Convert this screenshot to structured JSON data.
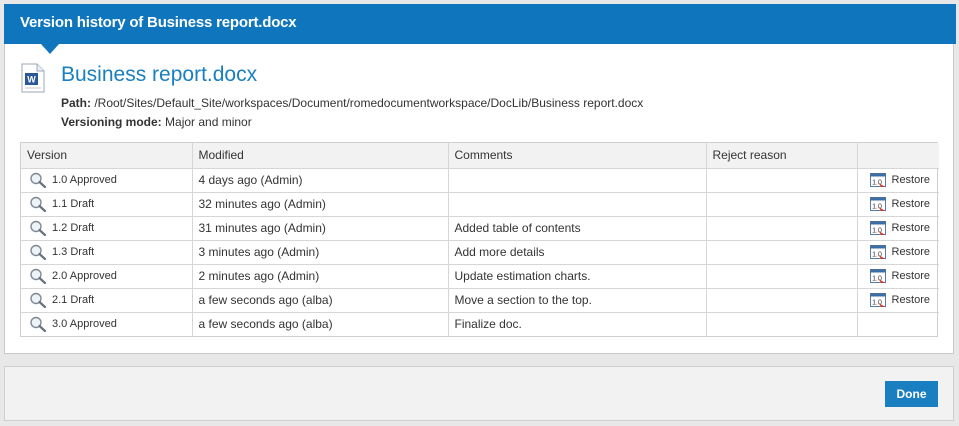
{
  "dialog": {
    "title": "Version history of Business report.docx"
  },
  "document": {
    "name": "Business report.docx",
    "icon": "word-document-icon",
    "path_label": "Path:",
    "path_value": " /Root/Sites/Default_Site/workspaces/Document/romedocumentworkspace/DocLib/Business report.docx",
    "mode_label": "Versioning mode:",
    "mode_value": " Major and minor"
  },
  "table": {
    "headers": [
      "Version",
      "Modified",
      "Comments",
      "Reject reason",
      ""
    ],
    "rows": [
      {
        "version": "1.0 Approved",
        "modified": "4 days ago (Admin)",
        "comments": "",
        "reject": "",
        "restore": "Restore"
      },
      {
        "version": "1.1 Draft",
        "modified": "32 minutes ago (Admin)",
        "comments": "",
        "reject": "",
        "restore": "Restore"
      },
      {
        "version": "1.2 Draft",
        "modified": "31 minutes ago (Admin)",
        "comments": "Added table of contents",
        "reject": "",
        "restore": "Restore"
      },
      {
        "version": "1.3 Draft",
        "modified": "3 minutes ago (Admin)",
        "comments": "Add more details",
        "reject": "",
        "restore": "Restore"
      },
      {
        "version": "2.0 Approved",
        "modified": "2 minutes ago (Admin)",
        "comments": "Update estimation charts.",
        "reject": "",
        "restore": "Restore"
      },
      {
        "version": "2.1 Draft",
        "modified": "a few seconds ago (alba)",
        "comments": "Move a section to the top.",
        "reject": "",
        "restore": "Restore"
      },
      {
        "version": "3.0 Approved",
        "modified": "a few seconds ago (alba)",
        "comments": "Finalize doc.",
        "reject": "",
        "restore": ""
      }
    ]
  },
  "footer": {
    "done_label": "Done"
  },
  "colors": {
    "accent": "#0f76bd",
    "link": "#1a7fc1"
  }
}
